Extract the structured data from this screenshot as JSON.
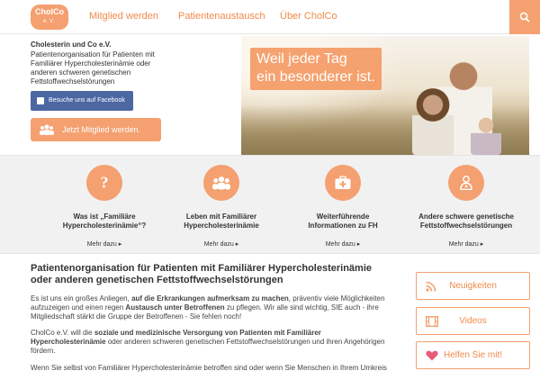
{
  "nav": {
    "logo_text": "CholCo",
    "logo_sub": "e.V.",
    "links": [
      "Mitglied werden",
      "Patientenaustausch",
      "Über CholCo"
    ]
  },
  "intro": {
    "name": "Cholesterin und Co e.V.",
    "text": "Patientenorganisation für Patienten mit Familiärer Hypercholesterinämie oder anderen schweren genetischen Fettstoffwechselstörungen",
    "facebook_label": "Besuche uns auf Facebook",
    "join_label": "Jetzt Mitglied werden."
  },
  "hero": {
    "line1": "Weil jeder Tag",
    "line2": "ein besonderer ist."
  },
  "features": [
    {
      "icon": "question-mark-icon",
      "title_line1": "Was ist „Familiäre",
      "title_line2": "Hypercholesterinämie“?",
      "more": "Mehr dazu"
    },
    {
      "icon": "group-icon",
      "title_line1": "Leben mit Familiärer",
      "title_line2": "Hypercholesterinämie",
      "more": "Mehr dazu"
    },
    {
      "icon": "first-aid-kit-icon",
      "title_line1": "Weiterführende",
      "title_line2": "Informationen zu FH",
      "more": "Mehr dazu"
    },
    {
      "icon": "doctor-icon",
      "title_line1": "Andere schwere genetische",
      "title_line2": "Fettstoffwechselstörungen",
      "more": "Mehr dazu"
    }
  ],
  "content": {
    "heading": "Patientenorganisation für Patienten mit Familiärer Hypercholesterinämie oder anderen genetischen Fettstoffwechselstörungen",
    "p1_a": "Es ist uns ein großes Anliegen, ",
    "p1_b": "auf die Erkrankungen aufmerksam zu machen",
    "p1_c": ", präventiv viele Möglichkeiten aufzuzeigen und einen regen ",
    "p1_d": "Austausch unter Betroffenen",
    "p1_e": " zu pflegen. Wir alle sind wichtig, SIE auch - ihre Mitgliedschaft stärkt die Gruppe der Betroffenen - Sie fehlen noch!",
    "p2_a": "CholCo e.V. will die ",
    "p2_b": "soziale und medizinische Versorgung von Patienten mit Familiärer Hypercholesterinämie",
    "p2_c": " oder anderen schweren genetischen Fettstoffwechselstörungen und ihren Angehörigen fördern.",
    "p3": "Wenn Sie selbst von Familiärer Hypercholesterinämie betroffen sind oder wenn Sie Menschen in Ihrem Umkreis"
  },
  "sidebar": {
    "buttons": [
      {
        "icon": "rss-icon",
        "label": "Neuigkeiten"
      },
      {
        "icon": "film-icon",
        "label": "Videos"
      },
      {
        "icon": "heart-icon",
        "label": "Helfen Sie mit!"
      }
    ]
  },
  "colors": {
    "accent": "#f4a070",
    "facebook": "#4d67a3",
    "band": "#f1f1f1"
  }
}
